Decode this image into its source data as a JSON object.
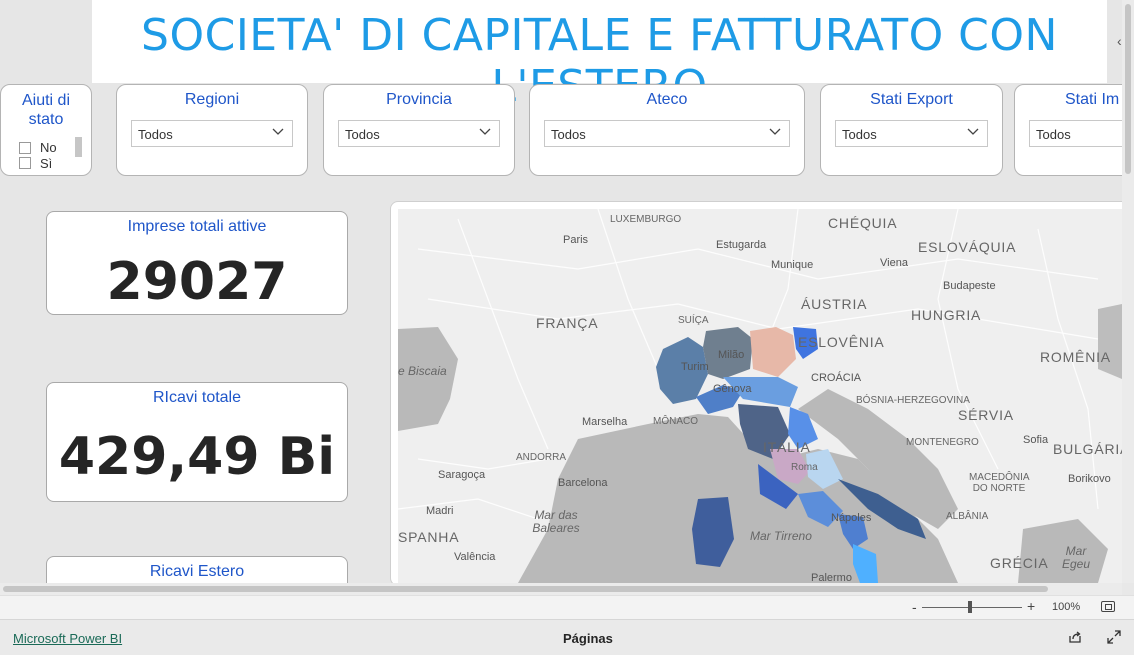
{
  "report": {
    "title": "SOCIETA' DI CAPITALE E FATTURATO CON L'ESTERO"
  },
  "slicers": {
    "aiuti": {
      "title": "Aiuti di stato",
      "title_line1": "Aiuti di",
      "title_line2": "stato",
      "options": [
        "No",
        "Sì"
      ]
    },
    "regioni": {
      "title": "Regioni",
      "value": "Todos"
    },
    "provincia": {
      "title": "Provincia",
      "value": "Todos"
    },
    "ateco": {
      "title": "Ateco",
      "value": "Todos"
    },
    "stati_export": {
      "title": "Stati Export",
      "value": "Todos"
    },
    "stati_import": {
      "title": "Stati Im",
      "value": "Todos"
    }
  },
  "cards": {
    "imprese": {
      "title": "Imprese totali attive",
      "value": "29027"
    },
    "ricavi": {
      "title": "RIcavi totale",
      "value": "429,49 Bi"
    },
    "estero": {
      "title": "Ricavi Estero",
      "value": ""
    }
  },
  "map": {
    "labels": {
      "luxemburgo": "LUXEMBURGO",
      "chequia": "CHÉQUIA",
      "paris": "Paris",
      "estugarda": "Estugarda",
      "eslovaquia": "ESLOVÁQUIA",
      "munique": "Munique",
      "viena": "Viena",
      "budapeste": "Budapeste",
      "austria": "ÁUSTRIA",
      "franca": "FRANÇA",
      "suica": "SUÍÇA",
      "hungria": "HUNGRIA",
      "eslovenia": "ESLOVÊNIA",
      "milao": "Milão",
      "turim": "Turim",
      "romenia": "ROMÊNIA",
      "croacia": "CROÁCIA",
      "biscaia": "e Biscaia",
      "genova": "Gênova",
      "bosnia": "BÓSNIA-HERZEGOVINA",
      "servia": "SÉRVIA",
      "marselha": "Marselha",
      "monaco": "MÔNACO",
      "italia": "ITÁLIA",
      "montenegro": "MONTENEGRO",
      "sofia": "Sofia",
      "andorra": "ANDORRA",
      "roma": "Roma",
      "bulgaria": "BULGÁRIA",
      "saragoca": "Saragoça",
      "barcelona": "Barcelona",
      "macedonia": "MACEDÔNIA DO NORTE",
      "borikovo": "Borikovo",
      "madri": "Madri",
      "mar_baleares": "Mar das Baleares",
      "napoles": "Nápoles",
      "albania": "ALBÂNIA",
      "espanha": "SPANHA",
      "mar_tirreno": "Mar Tirreno",
      "valencia": "Valência",
      "grecia": "GRÉCIA",
      "mar_egeu": "Mar Egeu",
      "palermo": "Palermo"
    }
  },
  "view": {
    "zoom_label": "100%"
  },
  "footer": {
    "brand_link": "Microsoft Power BI",
    "pages_label": "Páginas"
  }
}
